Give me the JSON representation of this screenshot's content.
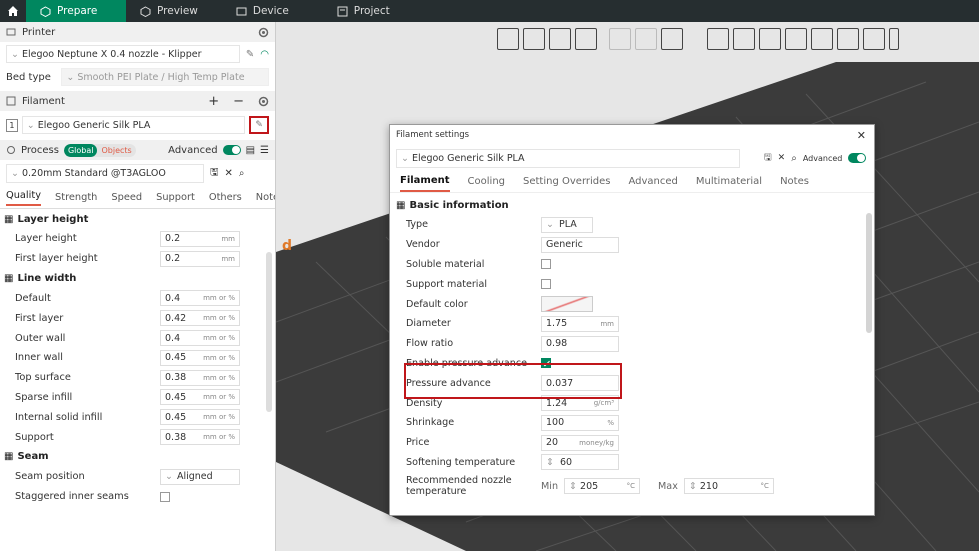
{
  "topbar": {
    "tabs": [
      {
        "label": "Prepare"
      },
      {
        "label": "Preview"
      },
      {
        "label": "Device"
      },
      {
        "label": "Project"
      }
    ]
  },
  "printer": {
    "header": "Printer",
    "name": "Elegoo Neptune X 0.4 nozzle - Klipper",
    "bed_label": "Bed type",
    "bed_value": "Smooth PEI Plate / High Temp Plate"
  },
  "filament": {
    "header": "Filament",
    "slot": "1",
    "name": "Elegoo Generic Silk PLA"
  },
  "process": {
    "header": "Process",
    "pill_on": "Global",
    "pill_off": "Objects",
    "advanced": "Advanced",
    "preset": "0.20mm Standard @T3AGLOO",
    "tabs": [
      "Quality",
      "Strength",
      "Speed",
      "Support",
      "Others",
      "Notes"
    ]
  },
  "quality": {
    "layer_height": {
      "title": "Layer height",
      "rows": [
        {
          "label": "Layer height",
          "value": "0.2",
          "unit": "mm"
        },
        {
          "label": "First layer height",
          "value": "0.2",
          "unit": "mm"
        }
      ]
    },
    "line_width": {
      "title": "Line width",
      "rows": [
        {
          "label": "Default",
          "value": "0.4",
          "unit": "mm or %"
        },
        {
          "label": "First layer",
          "value": "0.42",
          "unit": "mm or %"
        },
        {
          "label": "Outer wall",
          "value": "0.4",
          "unit": "mm or %"
        },
        {
          "label": "Inner wall",
          "value": "0.45",
          "unit": "mm or %"
        },
        {
          "label": "Top surface",
          "value": "0.38",
          "unit": "mm or %"
        },
        {
          "label": "Sparse infill",
          "value": "0.45",
          "unit": "mm or %"
        },
        {
          "label": "Internal solid infill",
          "value": "0.45",
          "unit": "mm or %"
        },
        {
          "label": "Support",
          "value": "0.38",
          "unit": "mm or %"
        }
      ]
    },
    "seam": {
      "title": "Seam",
      "position_label": "Seam position",
      "position_value": "Aligned",
      "staggered_label": "Staggered inner seams"
    }
  },
  "dialog": {
    "title": "Filament settings",
    "preset": "Elegoo Generic Silk PLA",
    "advanced": "Advanced",
    "tabs": [
      "Filament",
      "Cooling",
      "Setting Overrides",
      "Advanced",
      "Multimaterial",
      "Notes"
    ],
    "section": "Basic information",
    "type": {
      "label": "Type",
      "value": "PLA"
    },
    "vendor": {
      "label": "Vendor",
      "value": "Generic"
    },
    "soluble": {
      "label": "Soluble material"
    },
    "support": {
      "label": "Support material"
    },
    "color": {
      "label": "Default color"
    },
    "diameter": {
      "label": "Diameter",
      "value": "1.75",
      "unit": "mm"
    },
    "flow": {
      "label": "Flow ratio",
      "value": "0.98"
    },
    "epa": {
      "label": "Enable pressure advance"
    },
    "pa": {
      "label": "Pressure advance",
      "value": "0.037"
    },
    "density": {
      "label": "Density",
      "value": "1.24",
      "unit": "g/cm³"
    },
    "shrinkage": {
      "label": "Shrinkage",
      "value": "100",
      "unit": "%"
    },
    "price": {
      "label": "Price",
      "value": "20",
      "unit": "money/kg"
    },
    "softening": {
      "label": "Softening temperature",
      "value": "60"
    },
    "nozzle": {
      "label1": "Recommended nozzle",
      "label2": "temperature",
      "min_label": "Min",
      "min_value": "205",
      "max_label": "Max",
      "max_value": "210",
      "unit": "°C"
    }
  }
}
